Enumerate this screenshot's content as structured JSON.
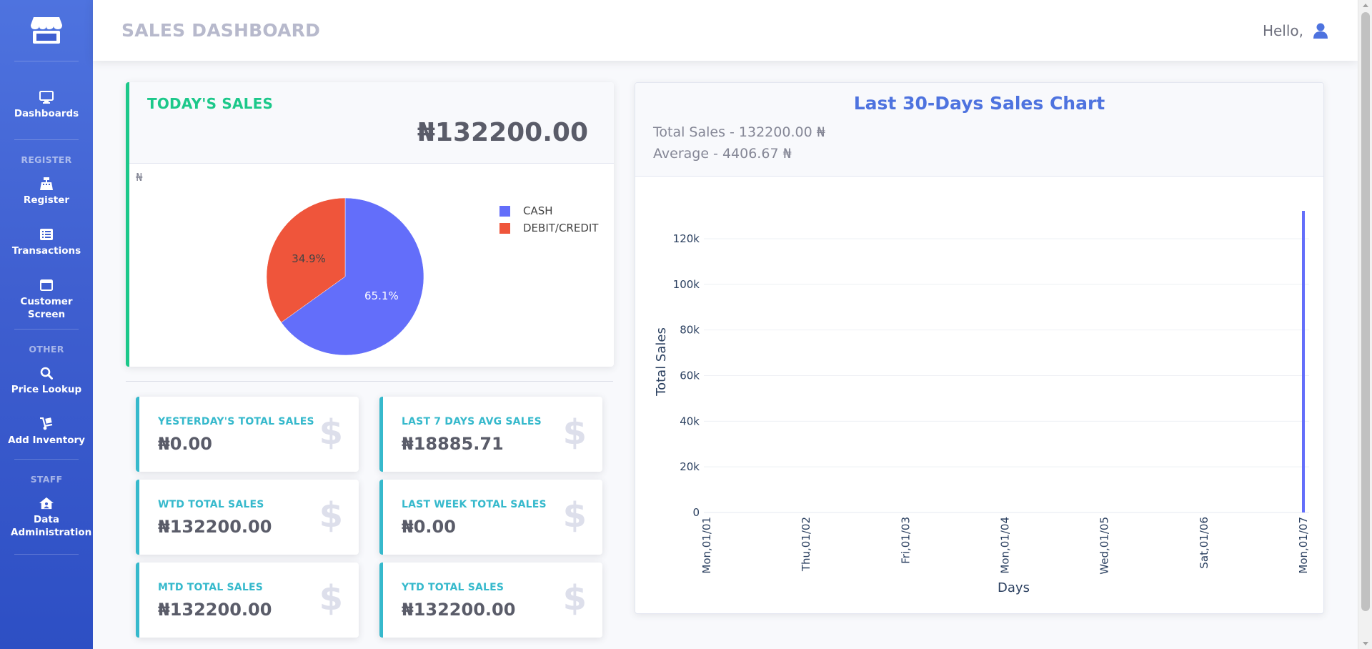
{
  "sidebar": {
    "items": [
      {
        "label": "Dashboards",
        "icon": "monitor-icon"
      },
      {
        "label": "Register",
        "icon": "cash-register-icon"
      },
      {
        "label": "Transactions",
        "icon": "list-icon"
      },
      {
        "label": "Customer Screen",
        "icon": "window-icon"
      },
      {
        "label": "Price Lookup",
        "icon": "search-icon"
      },
      {
        "label": "Add Inventory",
        "icon": "dolly-icon"
      },
      {
        "label": "Data Administration",
        "icon": "house-user-icon"
      }
    ],
    "headings": {
      "register": "REGISTER",
      "other": "OTHER",
      "staff": "STAFF"
    }
  },
  "topbar": {
    "title": "SALES DASHBOARD",
    "greeting": "Hello,"
  },
  "today": {
    "title": "TODAY'S SALES",
    "amount": "₦132200.00",
    "currency_mark": "₦",
    "pie": {
      "slices": [
        {
          "label": "CASH",
          "percent": 65.1,
          "percent_text": "65.1%",
          "color": "#636efa"
        },
        {
          "label": "DEBIT/CREDIT",
          "percent": 34.9,
          "percent_text": "34.9%",
          "color": "#ef553b"
        }
      ]
    }
  },
  "stats": [
    {
      "label": "YESTERDAY'S TOTAL SALES",
      "value": "₦0.00"
    },
    {
      "label": "LAST 7 DAYS AVG SALES",
      "value": "₦18885.71"
    },
    {
      "label": "WTD TOTAL SALES",
      "value": "₦132200.00"
    },
    {
      "label": "LAST WEEK TOTAL SALES",
      "value": "₦0.00"
    },
    {
      "label": "MTD TOTAL SALES",
      "value": "₦132200.00"
    },
    {
      "label": "YTD TOTAL SALES",
      "value": "₦132200.00"
    }
  ],
  "stat_icon": "$",
  "chart": {
    "title": "Last 30-Days Sales Chart",
    "total": "Total Sales - 132200.00 ₦",
    "average": "Average - 4406.67 ₦"
  },
  "chart_data": {
    "type": "bar",
    "title": "Last 30-Days Sales Chart",
    "xlabel": "Days",
    "ylabel": "Total Sales",
    "x_ticks": [
      "Mon,01/01",
      "Thu,01/02",
      "Fri,01/03",
      "Mon,01/04",
      "Wed,01/05",
      "Sat,01/06",
      "Mon,01/07"
    ],
    "y_ticks": [
      "0",
      "20k",
      "40k",
      "60k",
      "80k",
      "100k",
      "120k"
    ],
    "ylim": [
      0,
      132200
    ],
    "series": [
      {
        "color": "#636efa",
        "points": [
          {
            "x": "Mon,01/07",
            "y": 132200
          }
        ]
      }
    ],
    "grid": true
  }
}
